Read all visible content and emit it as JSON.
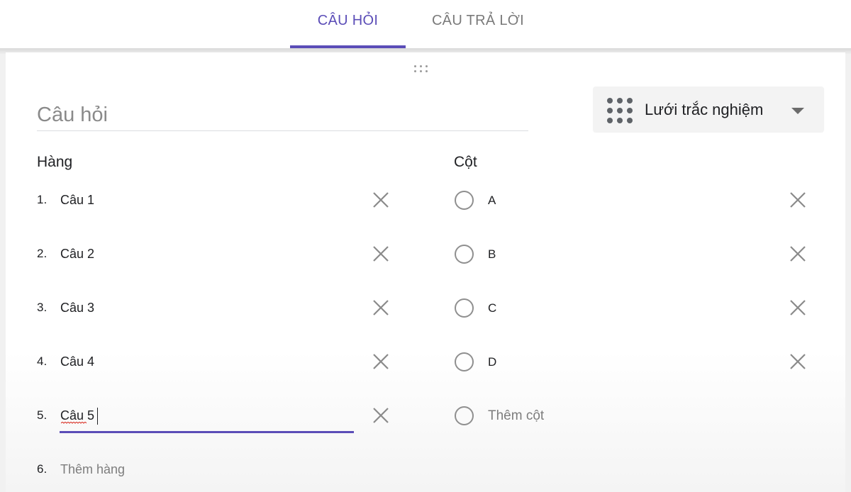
{
  "tabs": [
    {
      "label": "CÂU HỎI",
      "active": true
    },
    {
      "label": "CÂU TRẢ LỜI",
      "active": false
    }
  ],
  "question": {
    "placeholder": "Câu hỏi",
    "value": ""
  },
  "question_type": {
    "label": "Lưới trắc nghiệm",
    "icon": "grid-dots-icon"
  },
  "rows": {
    "heading": "Hàng",
    "items": [
      {
        "number": "1.",
        "label": "Câu 1"
      },
      {
        "number": "2.",
        "label": "Câu 2"
      },
      {
        "number": "3.",
        "label": "Câu 3"
      },
      {
        "number": "4.",
        "label": "Câu 4"
      },
      {
        "number": "5.",
        "label": "Câu 5"
      }
    ],
    "add": {
      "number": "6.",
      "label": "Thêm hàng"
    }
  },
  "columns": {
    "heading": "Cột",
    "items": [
      {
        "label": "A"
      },
      {
        "label": "B"
      },
      {
        "label": "C"
      },
      {
        "label": "D"
      }
    ],
    "add": {
      "label": "Thêm cột"
    }
  },
  "colors": {
    "accent": "#5b4db7",
    "icon_gray": "#8a8a8a"
  }
}
